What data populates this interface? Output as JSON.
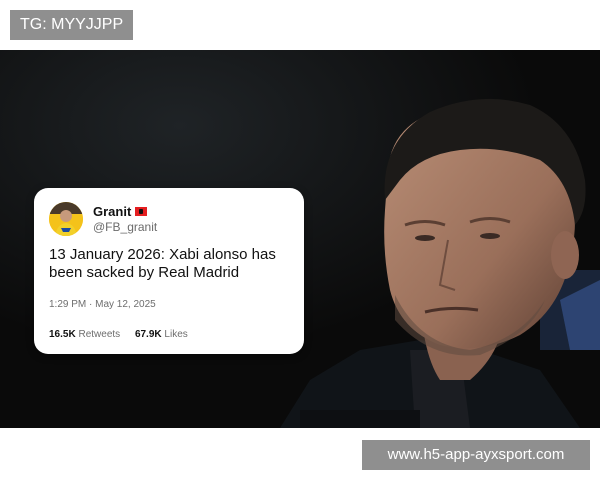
{
  "top_watermark": "TG: MYYJJPP",
  "bottom_watermark": "www.h5-app-ayxsport.com",
  "tweet": {
    "display_name": "Granit",
    "handle": "@FB_granit",
    "text": "13 January 2026: Xabi alonso has been sacked by Real Madrid",
    "timestamp": "1:29 PM · May 12, 2025",
    "retweets_count": "16.5K",
    "retweets_label": "Retweets",
    "likes_count": "67.9K",
    "likes_label": "Likes"
  },
  "colors": {
    "watermark_bg": "#8f8f8f",
    "photo_bg": "#0c0c0c",
    "card_bg": "#ffffff"
  }
}
